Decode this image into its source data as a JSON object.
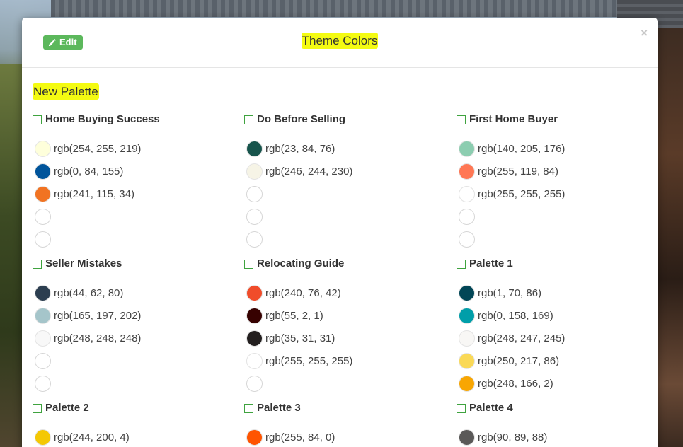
{
  "modal": {
    "edit_label": "Edit",
    "title": "Theme Colors",
    "close_glyph": "×"
  },
  "section": {
    "title": "New Palette"
  },
  "palettes": [
    {
      "name": "Home Buying Success",
      "colors": [
        {
          "label": "rgb(254, 255, 219)",
          "hex": "#feffdb"
        },
        {
          "label": "rgb(0, 84, 155)",
          "hex": "#00549b"
        },
        {
          "label": "rgb(241, 115, 34)",
          "hex": "#f17322"
        },
        {
          "label": "",
          "hex": ""
        },
        {
          "label": "",
          "hex": ""
        }
      ]
    },
    {
      "name": "Do Before Selling",
      "colors": [
        {
          "label": "rgb(23, 84, 76)",
          "hex": "#17544c"
        },
        {
          "label": "rgb(246, 244, 230)",
          "hex": "#f6f4e6"
        },
        {
          "label": "",
          "hex": ""
        },
        {
          "label": "",
          "hex": ""
        },
        {
          "label": "",
          "hex": ""
        }
      ]
    },
    {
      "name": "First Home Buyer",
      "colors": [
        {
          "label": "rgb(140, 205, 176)",
          "hex": "#8ccdb0"
        },
        {
          "label": "rgb(255, 119, 84)",
          "hex": "#ff7754"
        },
        {
          "label": "rgb(255, 255, 255)",
          "hex": "#ffffff"
        },
        {
          "label": "",
          "hex": ""
        },
        {
          "label": "",
          "hex": ""
        }
      ]
    },
    {
      "name": "Seller Mistakes",
      "colors": [
        {
          "label": "rgb(44, 62, 80)",
          "hex": "#2c3e50"
        },
        {
          "label": "rgb(165, 197, 202)",
          "hex": "#a5c5ca"
        },
        {
          "label": "rgb(248, 248, 248)",
          "hex": "#f8f8f8"
        },
        {
          "label": "",
          "hex": ""
        },
        {
          "label": "",
          "hex": ""
        }
      ]
    },
    {
      "name": "Relocating Guide",
      "colors": [
        {
          "label": "rgb(240, 76, 42)",
          "hex": "#f04c2a"
        },
        {
          "label": "rgb(55, 2, 1)",
          "hex": "#370201"
        },
        {
          "label": "rgb(35, 31, 31)",
          "hex": "#231f1f"
        },
        {
          "label": "rgb(255, 255, 255)",
          "hex": "#ffffff"
        },
        {
          "label": "",
          "hex": ""
        }
      ]
    },
    {
      "name": "Palette 1",
      "colors": [
        {
          "label": "rgb(1, 70, 86)",
          "hex": "#014656"
        },
        {
          "label": "rgb(0, 158, 169)",
          "hex": "#009ea9"
        },
        {
          "label": "rgb(248, 247, 245)",
          "hex": "#f8f7f5"
        },
        {
          "label": "rgb(250, 217, 86)",
          "hex": "#fad956"
        },
        {
          "label": "rgb(248, 166, 2)",
          "hex": "#f8a602"
        }
      ]
    },
    {
      "name": "Palette 2",
      "colors": [
        {
          "label": "rgb(244, 200, 4)",
          "hex": "#f4c804"
        }
      ]
    },
    {
      "name": "Palette 3",
      "colors": [
        {
          "label": "rgb(255, 84, 0)",
          "hex": "#ff5400"
        }
      ]
    },
    {
      "name": "Palette 4",
      "colors": [
        {
          "label": "rgb(90, 89, 88)",
          "hex": "#5a5958"
        }
      ]
    }
  ]
}
